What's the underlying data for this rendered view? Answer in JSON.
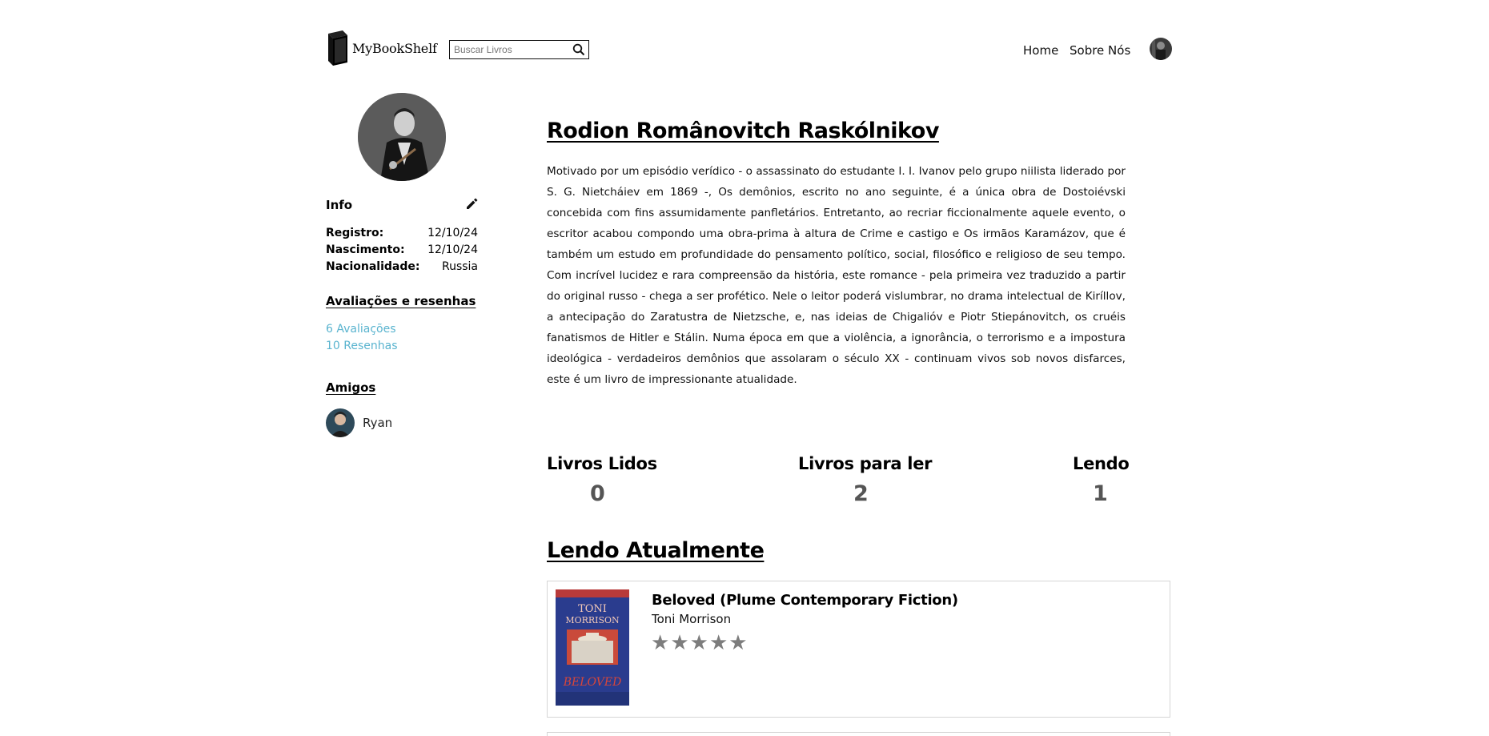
{
  "header": {
    "logo_text": "MyBookShelf",
    "search_placeholder": "Buscar Livros",
    "nav": [
      "Home",
      "Sobre Nós"
    ]
  },
  "sidebar": {
    "info_title": "Info",
    "info_rows": [
      {
        "label": "Registro:",
        "value": "12/10/24"
      },
      {
        "label": "Nascimento:",
        "value": "12/10/24"
      },
      {
        "label": "Nacionalidade:",
        "value": "Russia"
      }
    ],
    "reviews_heading": "Avaliações e resenhas",
    "ratings_link": "6 Avaliações",
    "reviews_link": "10 Resenhas",
    "friends_heading": "Amigos",
    "friends": [
      {
        "name": "Ryan"
      }
    ]
  },
  "profile": {
    "name": "Rodion Românovitch Raskólnikov",
    "bio": "Motivado por um episódio verídico - o assassinato do estudante I. I. Ivanov pelo grupo niilista liderado por S. G. Nietcháiev em 1869 -, Os demônios, escrito no ano seguinte, é a única obra de Dostoiévski concebida com fins assumidamente panfletários. Entretanto, ao recriar ficcionalmente aquele evento, o escritor acabou compondo uma obra-prima à altura de Crime e castigo e Os irmãos Karamázov, que é também um estudo em profundidade do pensamento político, social, filosófico e religioso de seu tempo. Com incrível lucidez e rara compreensão da história, este romance - pela primeira vez traduzido a partir do original russo - chega a ser profético. Nele o leitor poderá vislumbrar, no drama intelectual de Kiríllov, a antecipação do Zaratustra de Nietzsche, e, nas ideias de Chigalióv e Piotr Stiepánovitch, os cruéis fanatismos de Hitler e Stálin. Numa época em que a violência, a ignorância, o terrorismo e a impostura ideológica - verdadeiros demônios que assolaram o século XX - continuam vivos sob novos disfarces, este é um livro de impressionante atualidade."
  },
  "stats": [
    {
      "label": "Livros Lidos",
      "value": "0"
    },
    {
      "label": "Livros para ler",
      "value": "2"
    },
    {
      "label": "Lendo",
      "value": "1"
    }
  ],
  "currently_reading": {
    "heading": "Lendo Atualmente",
    "books": [
      {
        "title": "Beloved (Plume Contemporary Fiction)",
        "author": "Toni Morrison",
        "rating_stars": 5,
        "cover_text_top": "TONI MORRISON",
        "cover_text_bottom": "BELOVED"
      }
    ]
  },
  "colors": {
    "accent_link": "#5ab4cf",
    "stat_value": "#555555",
    "star": "#7d7d7d",
    "card_border": "#d6d6d6"
  }
}
